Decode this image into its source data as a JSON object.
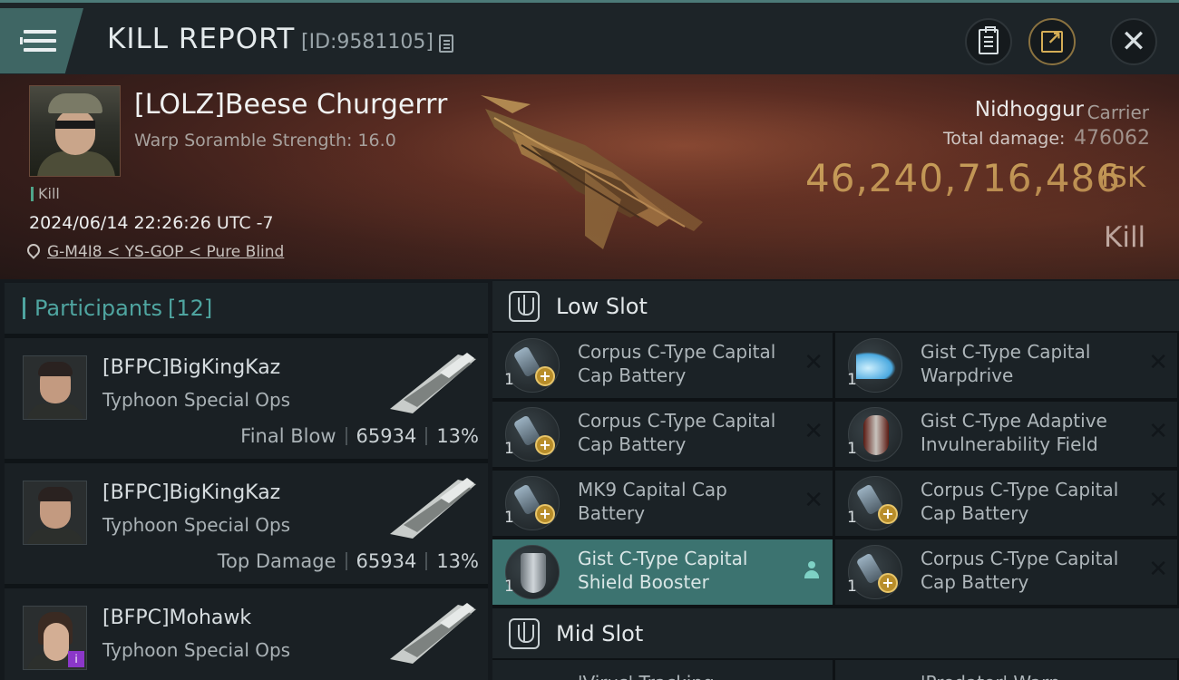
{
  "header": {
    "title": "KILL REPORT",
    "id_text": "[ID:9581105]"
  },
  "victim": {
    "name": "[LOLZ]Beese Churgerrr",
    "scramble": "Warp Soramble Strength: 16.0",
    "tag": "Kill",
    "time": "2024/06/14 22:26:26 UTC -7",
    "location": "G-M4I8 < YS-GOP < Pure Blind",
    "ship_name": "Nidhoggur",
    "ship_class": "Carrier",
    "damage_label": "Total damage:",
    "damage_value": "476062",
    "isk_value": "46,240,716,486",
    "isk_unit": "ISK",
    "result": "Kill"
  },
  "participants": {
    "header_label": "Participants",
    "count": "[12]",
    "rows": [
      {
        "name": "[BFPC]BigKingKaz",
        "ship": "Typhoon Special Ops",
        "role": "Final Blow",
        "damage": "65934",
        "percent": "13%"
      },
      {
        "name": "[BFPC]BigKingKaz",
        "ship": "Typhoon Special Ops",
        "role": "Top Damage",
        "damage": "65934",
        "percent": "13%"
      },
      {
        "name": "[BFPC]Mohawk",
        "ship": "Typhoon Special Ops",
        "badge": "i"
      }
    ]
  },
  "low_slot": {
    "label": "Low Slot",
    "modules": [
      {
        "qty": "1",
        "name": "Corpus C-Type Capital Cap Battery",
        "icon": "cap-battery-icon"
      },
      {
        "qty": "1",
        "name": "Gist C-Type Capital Warpdrive",
        "icon": "warpdrive-icon"
      },
      {
        "qty": "1",
        "name": "Corpus C-Type Capital Cap Battery",
        "icon": "cap-battery-icon"
      },
      {
        "qty": "1",
        "name": "Gist C-Type Adaptive Invulnerability Field",
        "icon": "shield-field-icon"
      },
      {
        "qty": "1",
        "name": "MK9 Capital Cap Battery",
        "icon": "cap-battery-icon"
      },
      {
        "qty": "1",
        "name": "Corpus C-Type Capital Cap Battery",
        "icon": "cap-battery-icon"
      },
      {
        "qty": "1",
        "name": "Gist C-Type Capital Shield Booster",
        "icon": "shield-booster-icon",
        "selected": true
      },
      {
        "qty": "1",
        "name": "Corpus C-Type Capital Cap Battery",
        "icon": "cap-battery-icon"
      }
    ]
  },
  "mid_slot": {
    "label": "Mid Slot",
    "modules": [
      {
        "name": "'Virus' Tracking"
      },
      {
        "name": "'Predator' Warp"
      }
    ]
  },
  "colors": {
    "accent_teal": "#4fa5a0",
    "isk_gold": "#e3bf6a",
    "selected_row": "#3c7370"
  }
}
